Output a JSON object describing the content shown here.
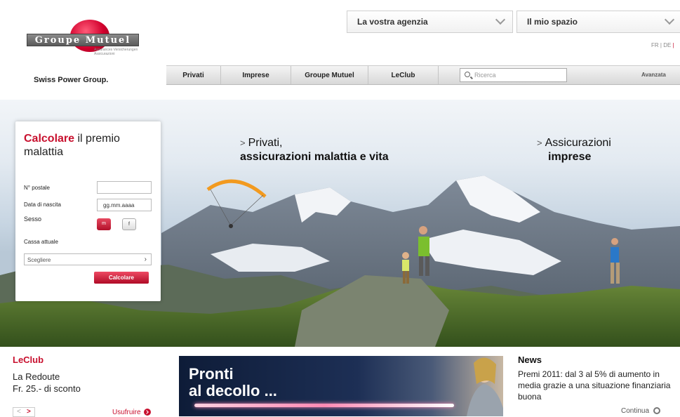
{
  "brand": {
    "logo_text": "Groupe Mutuel",
    "logo_subtext": "Assurances Versicherungen Assicurazioni",
    "tagline": "Swiss Power Group."
  },
  "header": {
    "agency_dropdown": "La vostra agenzia",
    "myspace_dropdown": "Il mio spazio",
    "languages": {
      "fr": "FR",
      "de": "DE",
      "sep": "|"
    }
  },
  "nav": {
    "items": [
      "Privati",
      "Imprese",
      "Groupe Mutuel",
      "LeClub"
    ],
    "search_placeholder": "Ricerca",
    "advanced": "Avanzata"
  },
  "hero": {
    "private_line1": "Privati,",
    "private_line2": "assicurazioni malattia e vita",
    "business_line1": "Assicurazioni",
    "business_line2": "imprese",
    "arrow": ">"
  },
  "calculator": {
    "title_red": "Calcolare",
    "title_rest": " il premio malattia",
    "postal_label": "N° postale",
    "postal_value": "",
    "birth_label": "Data di nascita",
    "birth_placeholder": "gg.mm.aaaa",
    "sex_label": "Sesso",
    "sex_m": "m",
    "sex_f": "f",
    "current_label": "Cassa attuale",
    "select_value": "Scegliere",
    "submit": "Calcolare"
  },
  "leclub": {
    "title": "LeClub",
    "promo_line1": "La Redoute",
    "promo_line2": "Fr. 25.- di sconto",
    "prev": "<",
    "next": ">",
    "cta": "Usufruire"
  },
  "banner": {
    "line1": "Pronti",
    "line2": "al decollo ..."
  },
  "news": {
    "title": "News",
    "body": "Premi 2011: dal 3 al 5% di aumento in media grazie a una situazione finanziaria buona",
    "more": "Continua"
  },
  "colors": {
    "brand_red": "#c8102e",
    "nav_bg": "#e4e4e4",
    "banner_dark": "#0e1c38"
  }
}
